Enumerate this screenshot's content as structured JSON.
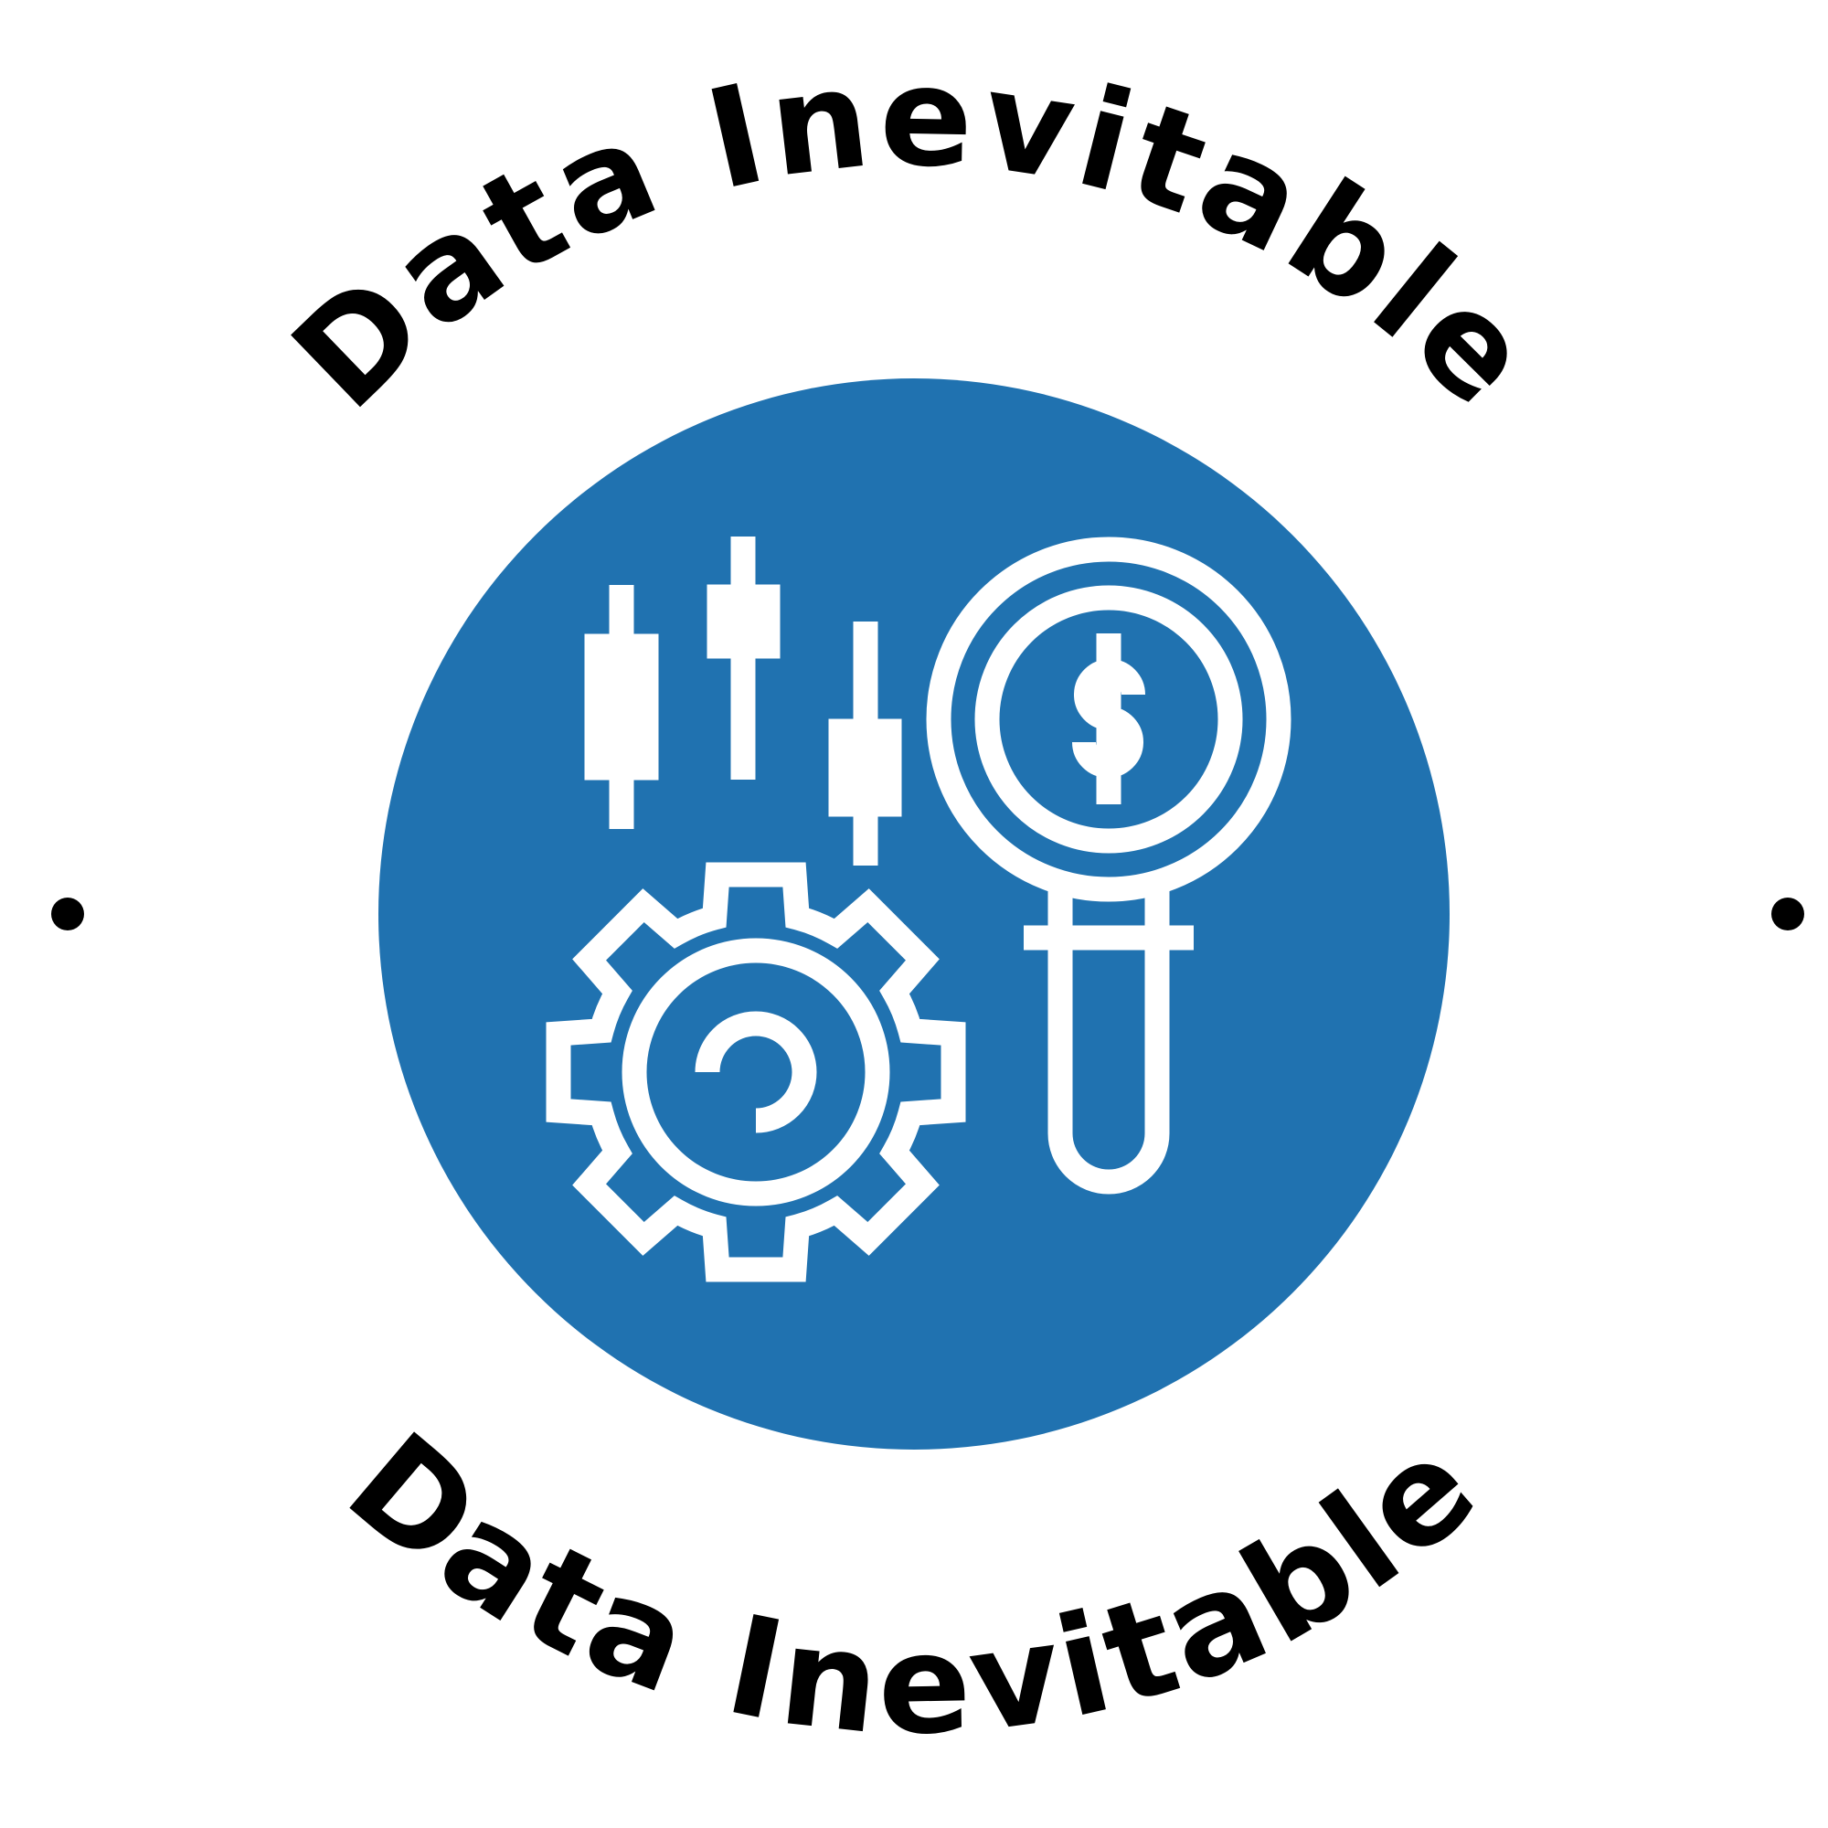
{
  "logo": {
    "top_text": "Data Inevitable",
    "bottom_text": "Data Inevitable",
    "colors": {
      "circle": "#2072b0",
      "icon": "#ffffff",
      "text": "#000000",
      "background": "#ffffff"
    },
    "icons": [
      "candlestick-chart-icon",
      "magnifying-glass-dollar-icon",
      "gear-icon"
    ]
  }
}
